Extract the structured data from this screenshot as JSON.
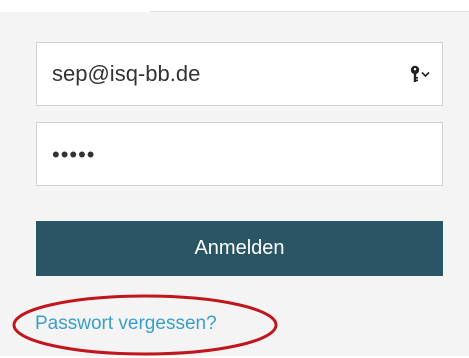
{
  "login_form": {
    "email": {
      "value": "sep@isq-bb.de",
      "icon": "key-icon"
    },
    "password": {
      "value": "•••••"
    },
    "submit_label": "Anmelden",
    "forgot_password_label": "Passwort vergessen?"
  },
  "annotation": {
    "shape": "ellipse",
    "color": "#c0161d",
    "target": "forgot-password-link"
  },
  "colors": {
    "background": "#f4f4f4",
    "button": "#2a5564",
    "link": "#3a9fc6"
  }
}
